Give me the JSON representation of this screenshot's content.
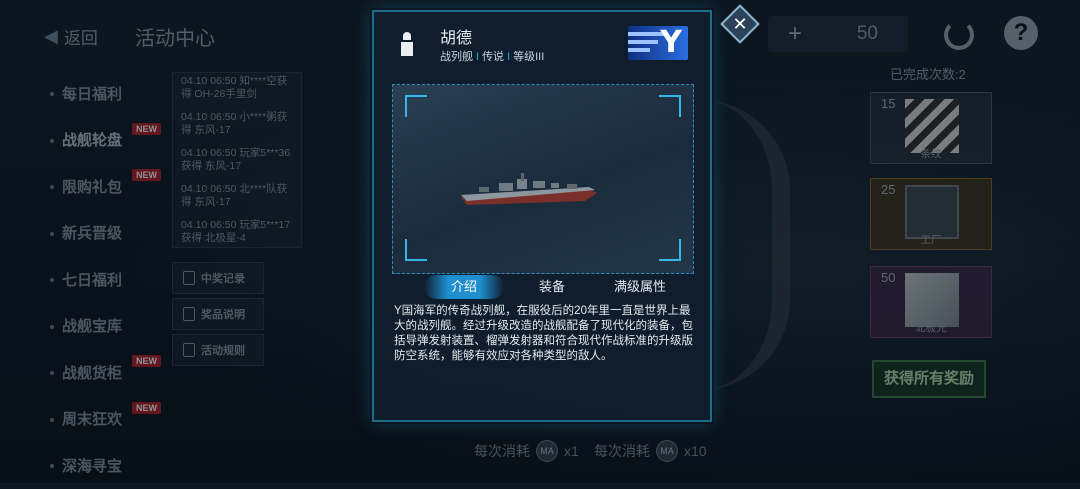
{
  "topbar": {
    "back_label": "返回",
    "title": "活动中心",
    "resource_count": "50",
    "help_symbol": "?"
  },
  "sidebar": {
    "items": [
      {
        "label": "每日福利",
        "new": false
      },
      {
        "label": "战舰轮盘",
        "new": true
      },
      {
        "label": "限购礼包",
        "new": true
      },
      {
        "label": "新兵晋级",
        "new": false
      },
      {
        "label": "七日福利",
        "new": false
      },
      {
        "label": "战舰宝库",
        "new": false
      },
      {
        "label": "战舰货柜",
        "new": true
      },
      {
        "label": "周末狂欢",
        "new": true
      },
      {
        "label": "深海寻宝",
        "new": false
      }
    ],
    "new_badge": "NEW"
  },
  "records": [
    "04.10 06:50 知****空获得 OH-28手里剑",
    "04.10 06:50 小****粥获得 东风-17",
    "04.10 06:50 玩家5***36获得 东风-17",
    "04.10 06:50 北****队获得 东风-17",
    "04.10 06:50 玩家5***17获得 北极星-4"
  ],
  "side_buttons": [
    "中奖记录",
    "奖品说明",
    "活动规则"
  ],
  "right_panel": {
    "completed": "已完成次数:2",
    "prizes": [
      {
        "count": "15",
        "name": "条纹"
      },
      {
        "count": "25",
        "name": "工厂"
      },
      {
        "count": "50",
        "name": "北极光"
      }
    ],
    "get_all": "获得所有奖励"
  },
  "costs": [
    {
      "label": "每次消耗",
      "coin": "MA",
      "qty": "x1"
    },
    {
      "label": "每次消耗",
      "coin": "MA",
      "qty": "x10"
    }
  ],
  "modal": {
    "ship_name": "胡德",
    "tag1": "战列舰",
    "tag2": "传说",
    "tag3": "等级III",
    "tag_sep": "I",
    "flag_letter": "Y",
    "close_symbol": "✕",
    "tabs": [
      {
        "label": "介绍",
        "active": true
      },
      {
        "label": "装备",
        "active": false
      },
      {
        "label": "满级属性",
        "active": false
      }
    ],
    "description": "Y国海军的传奇战列舰，在服役后的20年里一直是世界上最大的战列舰。经过升级改造的战舰配备了现代化的装备，包括导弹发射装置、榴弹发射器和符合现代作战标准的升级版防空系统，能够有效应对各种类型的敌人。"
  },
  "colors": {
    "accent": "#1f8fcf",
    "frame": "#1f6b8c",
    "new_badge": "#b3222a"
  }
}
